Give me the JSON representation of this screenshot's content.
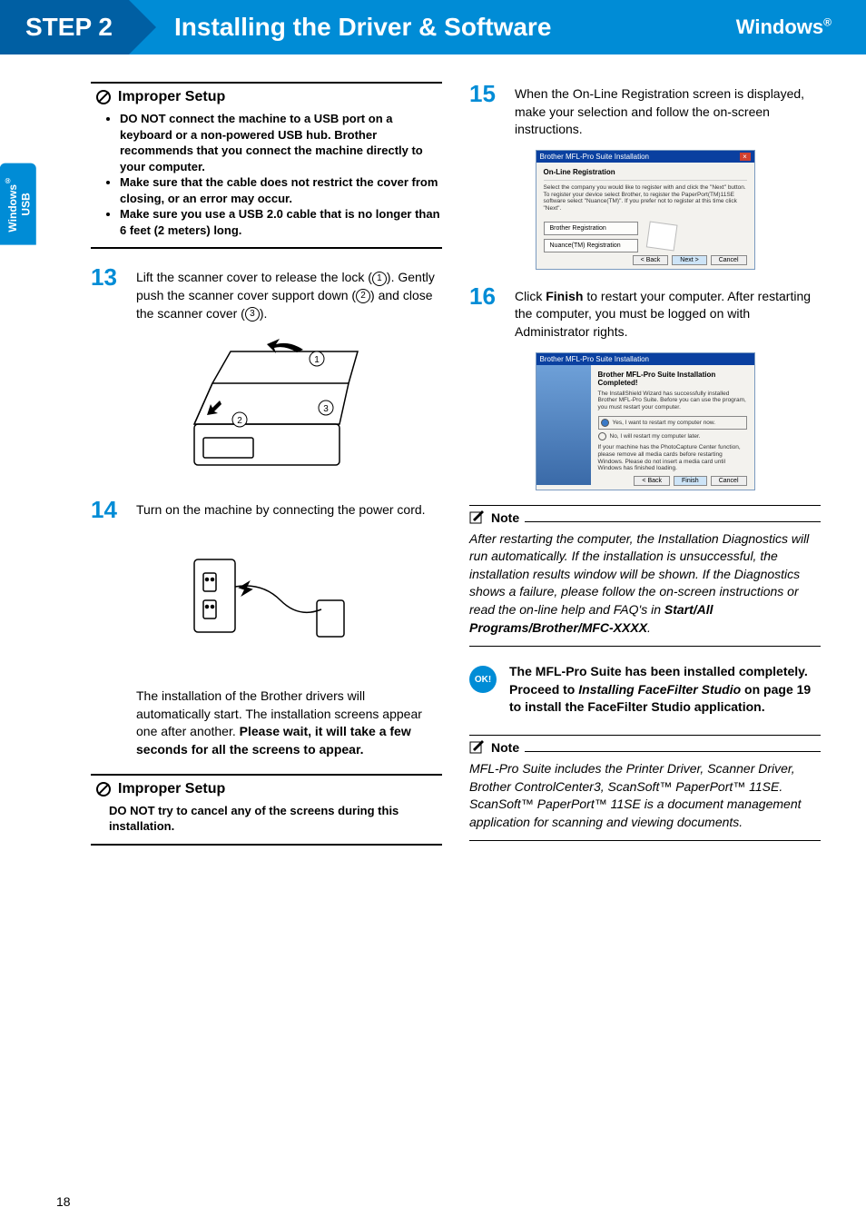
{
  "header": {
    "step_label": "STEP 2",
    "title": "Installing the Driver & Software",
    "platform": "Windows",
    "platform_sup": "®"
  },
  "side_tab": {
    "line1": "Windows",
    "sup": "®",
    "line2": "USB"
  },
  "page_number": "18",
  "improper_setup_1": {
    "title": "Improper Setup",
    "items": [
      "DO NOT connect the machine to a USB port on a keyboard or a non-powered USB hub. Brother recommends that you connect the machine directly to your computer.",
      "Make sure that the cable does not restrict the cover from closing, or an error may occur.",
      "Make sure you use a USB 2.0 cable that is no longer than 6 feet (2 meters) long."
    ]
  },
  "step13": {
    "num": "13",
    "text_a": "Lift the scanner cover to release the lock (",
    "circ1": "1",
    "text_b": "). Gently push the scanner cover support down (",
    "circ2": "2",
    "text_c": ") and close the scanner cover (",
    "circ3": "3",
    "text_d": ")."
  },
  "step14": {
    "num": "14",
    "text": "Turn on the machine by connecting the power cord.",
    "followup_a": "The installation of the Brother drivers will automatically start. The installation screens appear one after another. ",
    "followup_b": "Please wait, it will take a few seconds for all the screens to appear."
  },
  "improper_setup_2": {
    "title": "Improper Setup",
    "text": "DO NOT try to cancel any of the screens during this installation."
  },
  "step15": {
    "num": "15",
    "text": "When the On-Line Registration screen is displayed, make your selection and follow the on-screen instructions."
  },
  "dialog_reg": {
    "title": "Brother MFL-Pro Suite Installation",
    "heading": "On-Line Registration",
    "instr": "Select the company you would like to register with and click the \"Next\" button. To register your device select Brother, to register the PaperPort(TM)11SE software select \"Nuance(TM)\". If you prefer not to register at this time click \"Next\".",
    "btn1": "Brother Registration",
    "btn2": "Nuance(TM) Registration",
    "back": "< Back",
    "next": "Next >",
    "cancel": "Cancel"
  },
  "step16": {
    "num": "16",
    "text_a": "Click ",
    "finish": "Finish",
    "text_b": " to restart your computer. After restarting the computer, you must be logged on with Administrator rights."
  },
  "dialog_fin": {
    "title": "Brother MFL-Pro Suite Installation",
    "heading": "Brother MFL-Pro Suite Installation Completed!",
    "sub": "The InstallShield Wizard has successfully installed Brother MFL-Pro Suite. Before you can use the program, you must restart your computer.",
    "opt1": "Yes, I want to restart my computer now.",
    "opt2": "No, I will restart my computer later.",
    "warn": "If your machine has the PhotoCapture Center function, please remove all media cards before restarting Windows. Please do not insert a media card until Windows has finished loading.",
    "back": "< Back",
    "finish": "Finish",
    "cancel": "Cancel"
  },
  "note1": {
    "title": "Note",
    "text_a": "After restarting the computer, the Installation Diagnostics will run automatically. If the installation is unsuccessful, the installation results window will be shown. If the Diagnostics shows a failure, please follow the on-screen instructions or read the on-line help and FAQ's in ",
    "path": "Start/All Programs/Brother/MFC-XXXX",
    "dot": "."
  },
  "ok_box": {
    "badge": "OK!",
    "text_a": "The MFL-Pro Suite has been installed completely. Proceed to ",
    "link": "Installing FaceFilter Studio",
    "text_b": " on page 19  to install the FaceFilter Studio application."
  },
  "note2": {
    "title": "Note",
    "text": "MFL-Pro Suite includes the Printer Driver, Scanner Driver, Brother ControlCenter3, ScanSoft™ PaperPort™ 11SE. ScanSoft™ PaperPort™ 11SE is a document management application for scanning and viewing documents."
  }
}
